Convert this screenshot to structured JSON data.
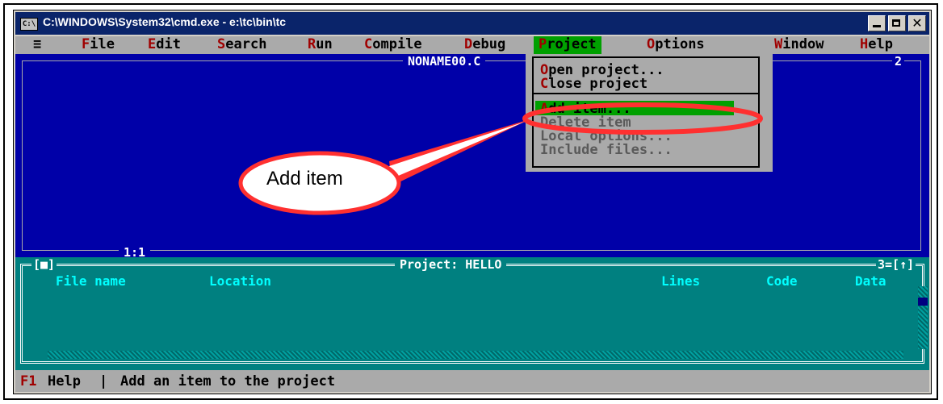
{
  "window": {
    "icon_text": "C:\\",
    "title": "C:\\WINDOWS\\System32\\cmd.exe - e:\\tc\\bin\\tc",
    "minimize_icon": "minimize-icon",
    "maximize_icon": "maximize-icon",
    "close_icon": "close-icon"
  },
  "menubar": {
    "system": "≡",
    "items": [
      {
        "hotkey": "F",
        "rest": "ile"
      },
      {
        "hotkey": "E",
        "rest": "dit"
      },
      {
        "hotkey": "S",
        "rest": "earch"
      },
      {
        "hotkey": "R",
        "rest": "un"
      },
      {
        "hotkey": "C",
        "rest": "ompile"
      },
      {
        "hotkey": "D",
        "rest": "ebug"
      },
      {
        "hotkey": "P",
        "rest": "roject"
      },
      {
        "hotkey": "O",
        "rest": "ptions"
      },
      {
        "hotkey": "W",
        "rest": "indow"
      },
      {
        "hotkey": "H",
        "rest": "elp"
      }
    ],
    "active": "Project"
  },
  "editor": {
    "title": "NONAME00.C",
    "window_number": "2",
    "cursor_position": "1:1"
  },
  "project_menu": {
    "items": [
      {
        "hotkey": "O",
        "rest": "pen project...",
        "enabled": true
      },
      {
        "hotkey": "C",
        "rest": "lose project",
        "enabled": true
      },
      {
        "hotkey": "A",
        "rest": "dd item...",
        "enabled": true,
        "highlighted": true
      },
      {
        "hotkey": "",
        "rest": "Delete item",
        "enabled": false
      },
      {
        "hotkey": "",
        "rest": "Local options...",
        "enabled": false
      },
      {
        "hotkey": "",
        "rest": "Include files...",
        "enabled": false
      }
    ]
  },
  "project_window": {
    "close_box": "[■]",
    "title": "Project: HELLO",
    "window_number": "3=[↑]",
    "columns": [
      "File name",
      "Location",
      "Lines",
      "Code",
      "Data"
    ]
  },
  "statusbar": {
    "key": "F1",
    "key_label": "Help",
    "separator": "|",
    "hint": "Add an item to the project"
  },
  "annotation": {
    "callout_text": "Add item",
    "color": "#ff3030"
  }
}
